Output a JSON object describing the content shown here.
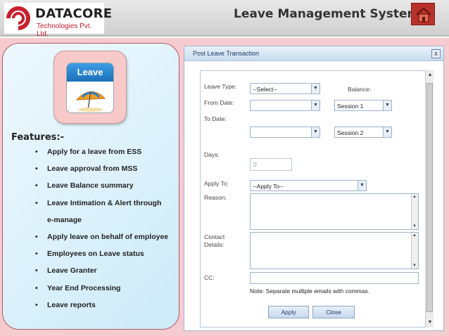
{
  "header": {
    "company_name": "DATACORE",
    "company_subtitle": "Technologies Pvt. Ltd.",
    "app_title": "Leave Management System",
    "home_icon": "home-icon",
    "brand_color": "#c8202e"
  },
  "left_panel": {
    "app_icon_label": "Leave",
    "features_title": "Features:-",
    "features": [
      "Apply for  a leave  from ESS",
      "Leave approval from  MSS",
      "Leave Balance summary",
      "Leave Intimation & Alert through",
      "e-manage",
      "Apply leave on behalf of employee",
      "Employees on Leave status",
      "Leave Granter",
      "Year End Processing",
      "Leave reports"
    ],
    "bullet": "•"
  },
  "dialog": {
    "title": "Post Leave Transaction",
    "close_label": "x",
    "leave_type_label": "Leave Type:",
    "leave_type_value": "--Select--",
    "balance_label": "Balance:",
    "from_date_label": "From Date:",
    "from_date_value": "",
    "from_session_value": "Session 1",
    "to_date_label": "To Date:",
    "to_date_value": "",
    "to_session_value": "Session 2",
    "days_label": "Days:",
    "days_value": "0",
    "apply_to_label": "Apply To:",
    "apply_to_value": "--Apply To--",
    "reason_label": "Reason:",
    "contact_label_1": "Contact",
    "contact_label_2": "Details:",
    "cc_label": "CC:",
    "note": "Note: Separate multiple emails with commas.",
    "apply_button": "Apply",
    "close_button": "Close"
  }
}
